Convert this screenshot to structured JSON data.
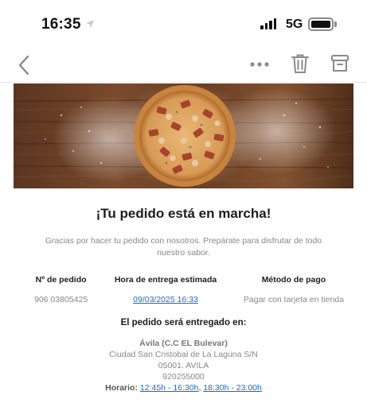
{
  "status_bar": {
    "time": "16:35",
    "network": "5G"
  },
  "nav": {
    "back_icon": "chevron-left-icon",
    "more_icon": "more-horizontal-icon",
    "trash_icon": "trash-icon",
    "archive_icon": "archive-icon"
  },
  "email": {
    "hero_image": "pizza-on-wooden-table",
    "headline": "¡Tu pedido está en marcha!",
    "thanks_text": "Gracias por hacer tu pedido con nosotros. Prepárate para disfrutar de todo nuestro sabor.",
    "order": {
      "number_label": "Nº de pedido",
      "number_value": "906 03805425",
      "time_label": "Hora de entrega estimada",
      "time_value": "09/03/2025 16:33",
      "payment_label": "Método de pago",
      "payment_value": "Pagar con tarjeta en tienda"
    },
    "delivery_title": "El pedido será entregado en:",
    "store": {
      "name": "Ávila (C.C EL Bulevar)",
      "address": "Ciudad San Cristobal de La Laguna S/N",
      "city": "05001. AVILA",
      "phone": "920255000",
      "hours_label": "Horario:",
      "hours_1": "12:45h - 16:30h",
      "hours_sep": ", ",
      "hours_2": "18:30h - 23:00h"
    }
  },
  "colors": {
    "link": "#1a6bc4",
    "muted_text": "#888888",
    "heading_text": "#1d1d1d"
  }
}
